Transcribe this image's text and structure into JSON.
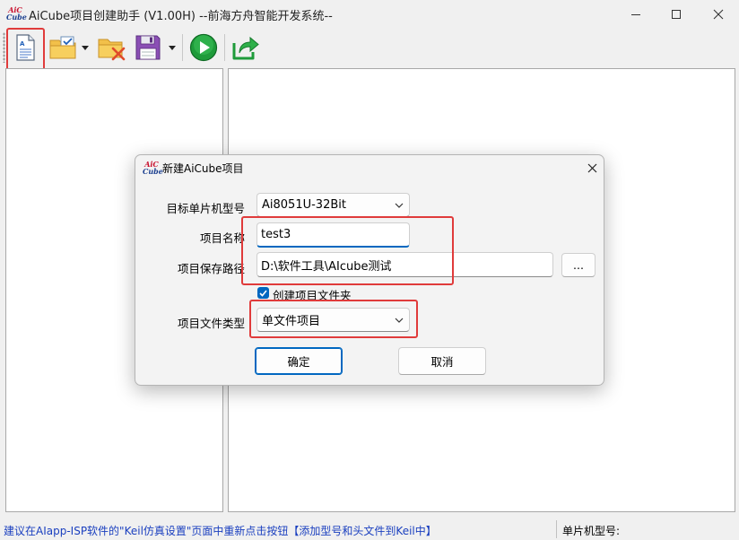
{
  "window": {
    "title": "AiCube项目创建助手 (V1.00H) --前海方舟智能开发系统--",
    "logo_line1": "AiC",
    "logo_line2": "Cube"
  },
  "toolbar": {
    "buttons": [
      {
        "name": "new-project",
        "icon": "new-document-icon"
      },
      {
        "name": "open-project",
        "icon": "folder-check-icon",
        "has_dropdown": true
      },
      {
        "name": "close-project",
        "icon": "folder-delete-icon"
      },
      {
        "name": "save-project",
        "icon": "floppy-disk-icon",
        "has_dropdown": true
      },
      {
        "name": "run",
        "icon": "green-play-icon"
      },
      {
        "name": "export",
        "icon": "green-share-arrow-icon"
      }
    ]
  },
  "dialog": {
    "title": "新建AiCube项目",
    "mcu_label": "目标单片机型号",
    "mcu_value": "Ai8051U-32Bit",
    "name_label": "项目名称",
    "name_value": "test3",
    "path_label": "项目保存路径",
    "path_value": "D:\\软件工具\\AIcube测试",
    "browse_label": "...",
    "create_folder_label": "创建项目文件夹",
    "create_folder_checked": true,
    "type_label": "项目文件类型",
    "type_value": "单文件项目",
    "ok_label": "确定",
    "cancel_label": "取消"
  },
  "statusbar": {
    "message": "建议在AIapp-ISP软件的\"Keil仿真设置\"页面中重新点击按钮【添加型号和头文件到Keil中】",
    "mcu_label": "单片机型号:"
  },
  "colors": {
    "accent": "#0067c0",
    "highlight": "#e03b3b",
    "status_text": "#1a3fbf"
  }
}
